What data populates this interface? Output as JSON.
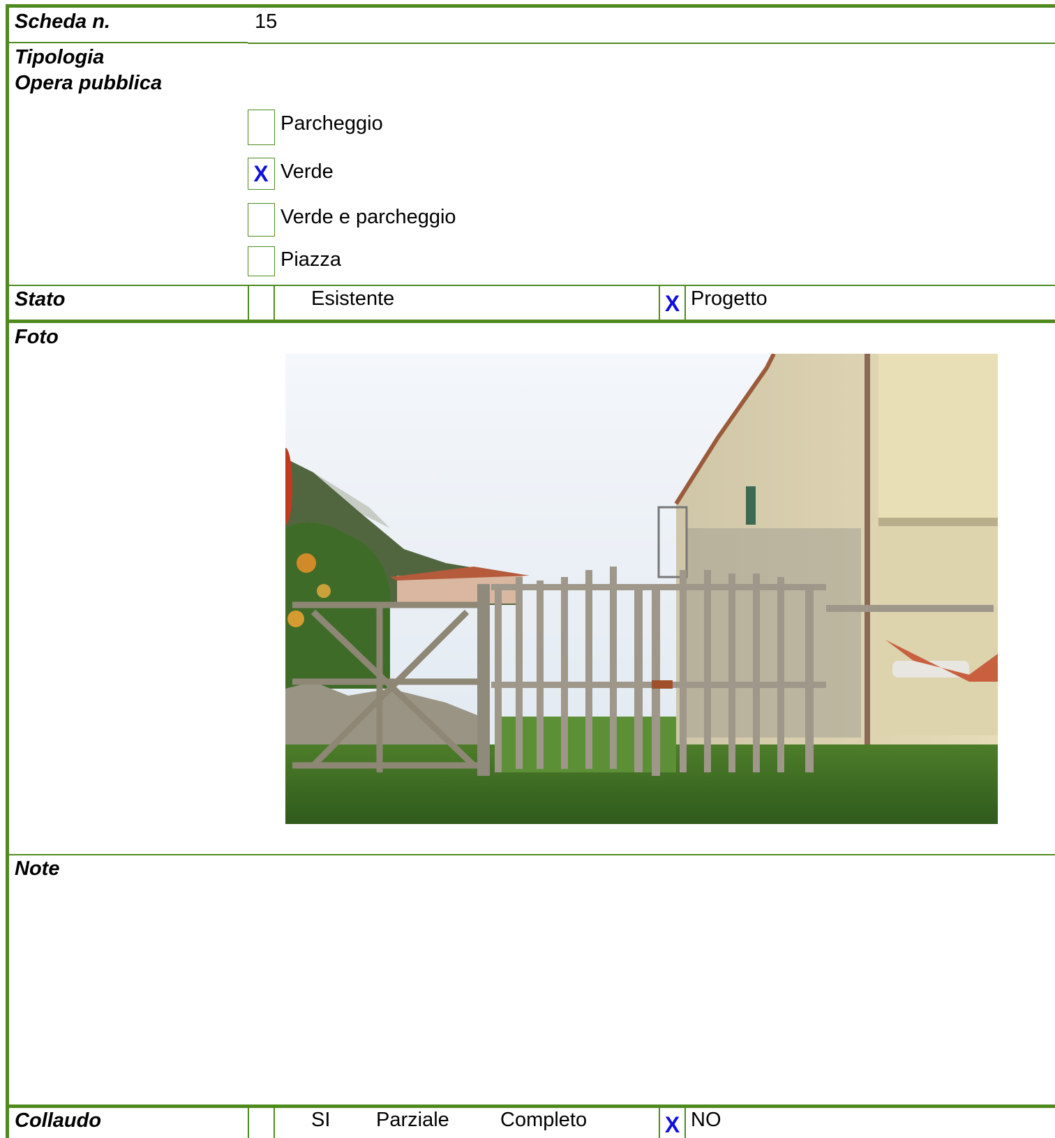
{
  "scheda": {
    "label": "Scheda n.",
    "value": "15"
  },
  "tipologia": {
    "label": "Tipologia",
    "sub_label": "Opera pubblica",
    "options": [
      {
        "label": "Parcheggio",
        "mark": ""
      },
      {
        "label": "Verde",
        "mark": "X"
      },
      {
        "label": "Verde e parcheggio",
        "mark": ""
      },
      {
        "label": "Piazza",
        "mark": ""
      }
    ]
  },
  "stato": {
    "label": "Stato",
    "esistente": {
      "label": "Esistente",
      "mark": ""
    },
    "progetto": {
      "label": "Progetto",
      "mark": "X"
    }
  },
  "foto": {
    "label": "Foto"
  },
  "note": {
    "label": "Note",
    "text": ""
  },
  "collaudo": {
    "label": "Collaudo",
    "options": [
      "SI",
      "Parziale",
      "Completo"
    ],
    "no": {
      "label": "NO",
      "mark": "X"
    }
  },
  "colors": {
    "border": "#4f8a1f",
    "mark": "#1010e0"
  }
}
